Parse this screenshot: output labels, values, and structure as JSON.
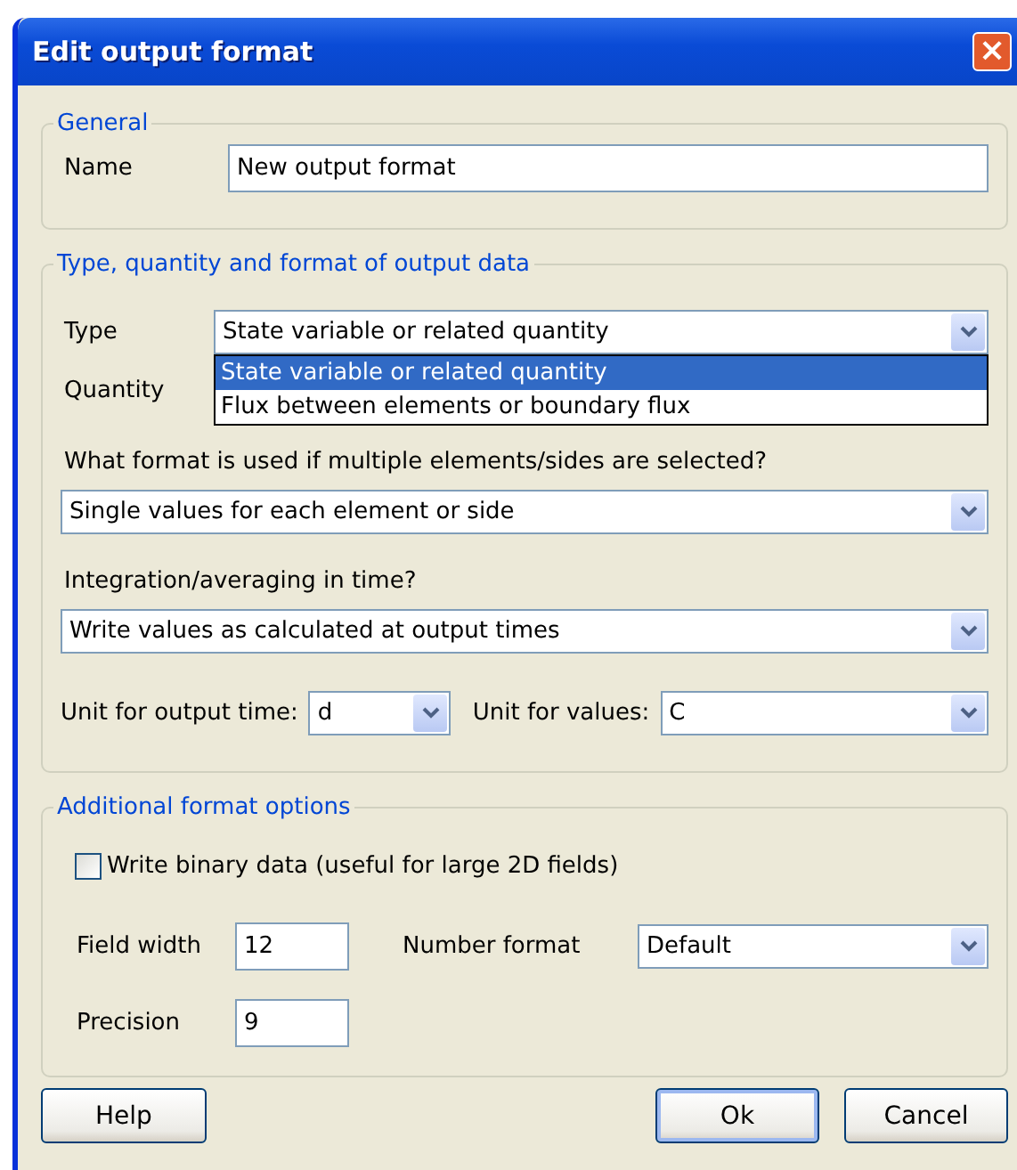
{
  "window": {
    "title": "Edit output format",
    "close": "×"
  },
  "general": {
    "legend": "General",
    "name_label": "Name",
    "name_value": "New output format"
  },
  "output": {
    "legend": "Type, quantity and format of output data",
    "type_label": "Type",
    "type_value": "State variable or related quantity",
    "type_options": [
      {
        "label": "State variable or related quantity",
        "selected": true
      },
      {
        "label": "Flux between elements or boundary flux",
        "selected": false
      }
    ],
    "quantity_label": "Quantity",
    "multi_label": "What format is used if multiple elements/sides are selected?",
    "multi_value": "Single values for each element or side",
    "time_label": "Integration/averaging in time?",
    "time_value": "Write values as calculated at output times",
    "unit_time_label": "Unit for output time:",
    "unit_time_value": "d",
    "unit_values_label": "Unit for values:",
    "unit_values_value": "C"
  },
  "additional": {
    "legend": "Additional format options",
    "binary_label": "Write binary data (useful for large 2D fields)",
    "binary_checked": false,
    "field_width_label": "Field width",
    "field_width_value": "12",
    "number_format_label": "Number format",
    "number_format_value": "Default",
    "precision_label": "Precision",
    "precision_value": "9"
  },
  "buttons": [
    {
      "label": "Help",
      "default": false
    },
    {
      "label": "Ok",
      "default": true
    },
    {
      "label": "Cancel",
      "default": false
    }
  ]
}
